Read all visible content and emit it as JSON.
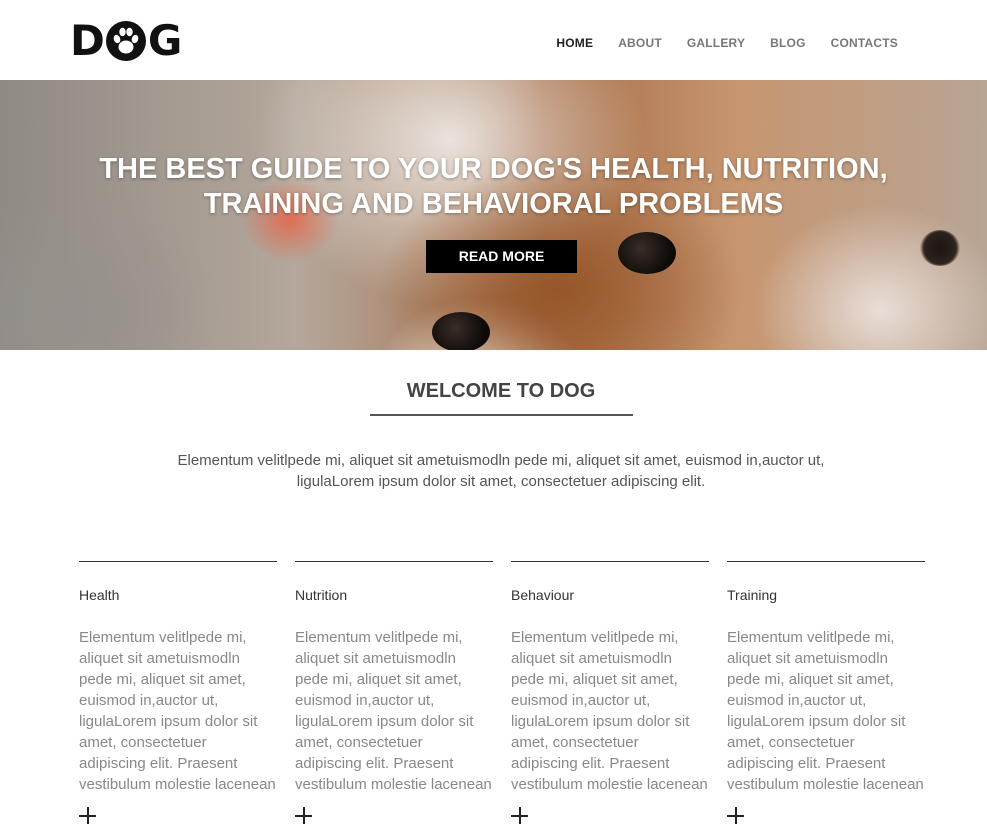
{
  "logo": {
    "text_left": "D",
    "text_right": "G",
    "paw_icon": "paw-icon"
  },
  "nav": {
    "items": [
      {
        "label": "HOME",
        "active": true
      },
      {
        "label": "ABOUT",
        "active": false
      },
      {
        "label": "GALLERY",
        "active": false
      },
      {
        "label": "BLOG",
        "active": false
      },
      {
        "label": "CONTACTS",
        "active": false
      }
    ]
  },
  "hero": {
    "title_line1": "THE BEST GUIDE TO YOUR DOG'S HEALTH, NUTRITION,",
    "title_line2": "TRAINING AND BEHAVIORAL PROBLEMS",
    "button": "READ MORE"
  },
  "welcome": {
    "title": "WELCOME TO DOG",
    "text_line1": "Elementum velitlpede mi, aliquet sit ametuismodln pede mi, aliquet sit amet, euismod in,auctor ut,",
    "text_line2": "ligulaLorem ipsum dolor sit amet, consectetuer adipiscing elit."
  },
  "columns": [
    {
      "heading": "Health",
      "body": "Elementum velitlpede mi, aliquet sit ametuismodln pede mi, aliquet sit amet, euismod in,auctor ut, ligulaLorem ipsum dolor sit amet, consectetuer adipiscing elit. Praesent vestibulum molestie lacenean"
    },
    {
      "heading": "Nutrition",
      "body": "Elementum velitlpede mi, aliquet sit ametuismodln pede mi, aliquet sit amet, euismod in,auctor ut, ligulaLorem ipsum dolor sit amet, consectetuer adipiscing elit. Praesent vestibulum molestie lacenean"
    },
    {
      "heading": "Behaviour",
      "body": "Elementum velitlpede mi, aliquet sit ametuismodln pede mi, aliquet sit amet, euismod in,auctor ut, ligulaLorem ipsum dolor sit amet, consectetuer adipiscing elit. Praesent vestibulum molestie lacenean"
    },
    {
      "heading": "Training",
      "body": "Elementum velitlpede mi, aliquet sit ametuismodln pede mi, aliquet sit amet, euismod in,auctor ut, ligulaLorem ipsum dolor sit amet, consectetuer adipiscing elit. Praesent vestibulum molestie lacenean"
    }
  ],
  "colors": {
    "button_bg": "#000000",
    "text_muted": "#888888",
    "heading": "#444444"
  }
}
